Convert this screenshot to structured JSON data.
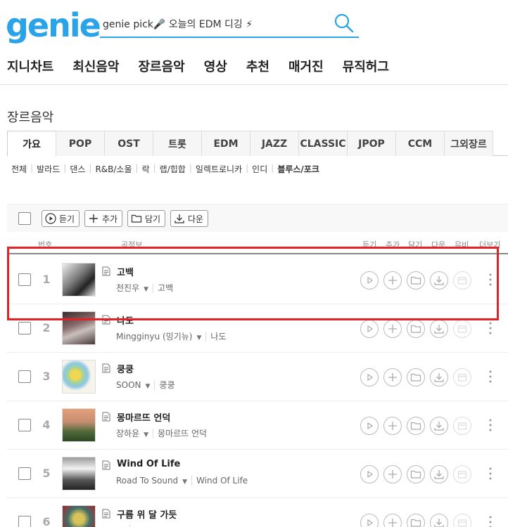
{
  "logo": "genie",
  "search": {
    "value": "genie pick🎤 오늘의 EDM 디깅 ⚡"
  },
  "gnb": [
    "지니차트",
    "최신음악",
    "장르음악",
    "영상",
    "추천",
    "매거진",
    "뮤직허그"
  ],
  "section_title": "장르음악",
  "genre_tabs": [
    "가요",
    "POP",
    "OST",
    "트롯",
    "EDM",
    "JAZZ",
    "CLASSIC",
    "JPOP",
    "CCM",
    "그외장르"
  ],
  "sub_genres": [
    "전체",
    "발라드",
    "댄스",
    "R&B/소울",
    "락",
    "랩/힙합",
    "일렉트로니카",
    "인디",
    "블루스/포크"
  ],
  "toolbar": {
    "listen": "듣기",
    "add": "추가",
    "save": "담기",
    "download": "다운"
  },
  "table_head": {
    "no": "번호",
    "song_info": "곡정보",
    "listen": "듣기",
    "add": "추가",
    "save": "담기",
    "download": "다운",
    "mv": "뮤비",
    "more": "더보기"
  },
  "songs": [
    {
      "no": "1",
      "title": "고백",
      "artist": "천진우",
      "album": "고백"
    },
    {
      "no": "2",
      "title": "나도",
      "artist": "Mingginyu (밍기뉴)",
      "album": "나도"
    },
    {
      "no": "3",
      "title": "쿵쿵",
      "artist": "SOON",
      "album": "쿵쿵"
    },
    {
      "no": "4",
      "title": "몽마르뜨 언덕",
      "artist": "장하윤",
      "album": "몽마르뜨 언덕"
    },
    {
      "no": "5",
      "title": "Wind Of Life",
      "artist": "Road To Sound",
      "album": "Wind Of Life"
    },
    {
      "no": "6",
      "title": "구름 위 달 가듯",
      "artist": "",
      "album": ""
    }
  ],
  "colors": {
    "brand": "#2aa3e8",
    "highlight": "#e32126"
  }
}
